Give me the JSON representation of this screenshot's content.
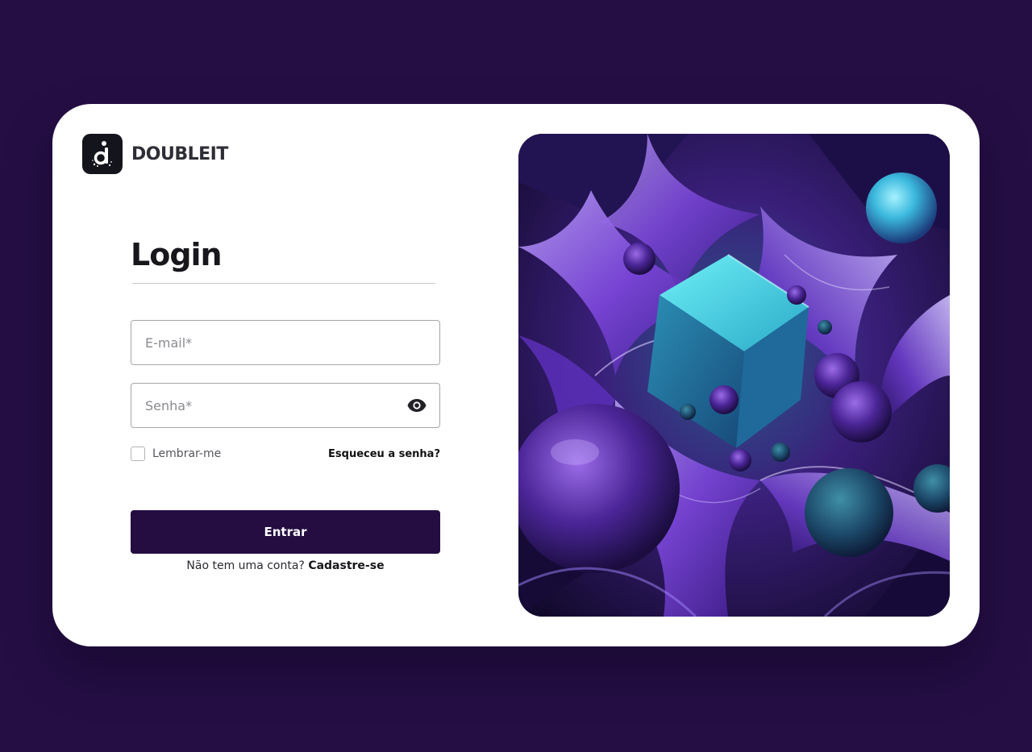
{
  "brand": {
    "name": "DOUBLEIT",
    "logo_icon": "doubleit-logo-icon"
  },
  "login": {
    "title": "Login",
    "email_placeholder": "E-mail*",
    "password_placeholder": "Senha*",
    "show_password_icon": "eye-icon",
    "remember_label": "Lembrar-me",
    "remember_checked": false,
    "forgot_label": "Esqueceu a senha?",
    "submit_label": "Entrar",
    "signup_prompt": "Não tem uma conta?",
    "signup_link": "Cadastre-se"
  },
  "colors": {
    "background": "#250e44",
    "card": "#ffffff",
    "button": "#250d42",
    "accent_purple": "#7b3fd6",
    "accent_cyan": "#3cc8e8"
  }
}
